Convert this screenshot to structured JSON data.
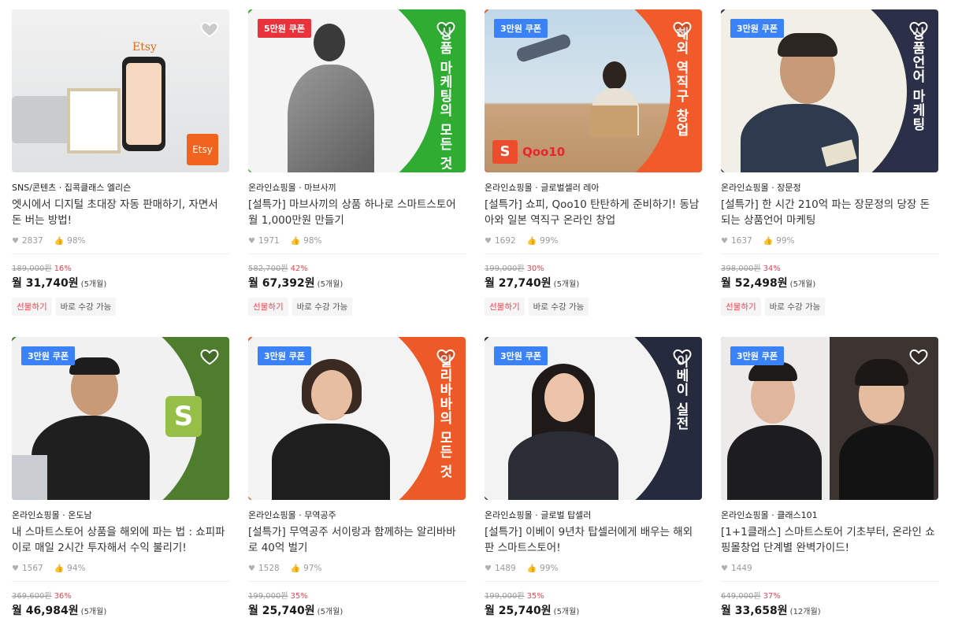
{
  "cards": [
    {
      "coupon": "",
      "banner": "",
      "meta": "SNS/콘텐츠 · 집콕클래스 엘리슨",
      "title": "엣시에서 디지털 초대장 자동 판매하기, 자면서 돈 버는 방법!",
      "likes": "2837",
      "rate": "98%",
      "orig": "189,000원",
      "discount": "16%",
      "price": "월 31,740원",
      "months": "(5개월)",
      "tag1": "선물하기",
      "tag2": "바로 수강 가능",
      "brand": "Etsy",
      "brand2": "Etsy"
    },
    {
      "coupon": "5만원 쿠폰",
      "banner": "상품 마케팅의 모든 것",
      "meta": "온라인쇼핑몰 · 마브사끼",
      "title": "[설특가] 마브사끼의 상품 하나로 스마트스토어 월 1,000만원 만들기",
      "likes": "1971",
      "rate": "98%",
      "orig": "582,700원",
      "discount": "42%",
      "price": "월 67,392원",
      "months": "(5개월)",
      "tag1": "선물하기",
      "tag2": "바로 수강 가능"
    },
    {
      "coupon": "3만원 쿠폰",
      "banner": "해외 역직구 창업",
      "meta": "온라인쇼핑몰 · 글로벌셀러 레아",
      "title": "[설특가] 쇼피, Qoo10 탄탄하게 준비하기! 동남아와 일본 역직구 온라인 창업",
      "likes": "1692",
      "rate": "99%",
      "orig": "199,000원",
      "discount": "30%",
      "price": "월 27,740원",
      "months": "(5개월)",
      "tag1": "선물하기",
      "tag2": "바로 수강 가능",
      "brand": "Qoo10",
      "brand2": "S"
    },
    {
      "coupon": "3만원 쿠폰",
      "banner": "상품언어 마케팅",
      "meta": "온라인쇼핑몰 · 장문정",
      "title": "[설특가] 한 시간 210억 파는 장문정의 당장 돈되는 상품언어 마케팅",
      "likes": "1637",
      "rate": "99%",
      "orig": "398,000원",
      "discount": "34%",
      "price": "월 52,498원",
      "months": "(5개월)",
      "tag1": "선물하기",
      "tag2": "바로 수강 가능"
    },
    {
      "coupon": "3만원 쿠폰",
      "banner": "",
      "meta": "온라인쇼핑몰 · 온도남",
      "title": "내 스마트스토어 상품을 해외에 파는 법 : 쇼피파이로 매일 2시간 투자해서 수익 불리기!",
      "likes": "1567",
      "rate": "94%",
      "orig": "369,600원",
      "discount": "36%",
      "price": "월 46,984원",
      "months": "(5개월)",
      "tag1": "",
      "tag2": ""
    },
    {
      "coupon": "3만원 쿠폰",
      "banner": "알리바바의 모든 것",
      "meta": "온라인쇼핑몰 · 무역공주",
      "title": "[설특가] 무역공주 서이랑과 함께하는 알리바바로 40억 벌기",
      "likes": "1528",
      "rate": "97%",
      "orig": "199,000원",
      "discount": "35%",
      "price": "월 25,740원",
      "months": "(5개월)",
      "tag1": "",
      "tag2": ""
    },
    {
      "coupon": "3만원 쿠폰",
      "banner": "이베이 실전",
      "meta": "온라인쇼핑몰 · 글로벌 탑셀러",
      "title": "[설특가] 이베이 9년차 탑셀러에게 배우는 해외판 스마트스토어!",
      "likes": "1489",
      "rate": "99%",
      "orig": "199,000원",
      "discount": "35%",
      "price": "월 25,740원",
      "months": "(5개월)",
      "tag1": "",
      "tag2": ""
    },
    {
      "coupon": "3만원 쿠폰",
      "banner": "",
      "meta": "온라인쇼핑몰 · 클래스101",
      "title": "[1+1클래스] 스마트스토어 기초부터, 온라인 쇼핑몰창업 단계별 완벽가이드!",
      "likes": "1449",
      "rate": "",
      "orig": "649,000원",
      "discount": "37%",
      "price": "월 33,658원",
      "months": "(12개월)",
      "tag1": "",
      "tag2": ""
    }
  ],
  "colors": {
    "coupon_red": "#e8323c",
    "coupon_blue": "#3b82f6",
    "green": "#2fad33",
    "orange": "#f15a2b",
    "navy": "#2c2f48",
    "olive": "#4f7d2e",
    "orange2": "#ee5a27",
    "navy2": "#262a3d"
  }
}
